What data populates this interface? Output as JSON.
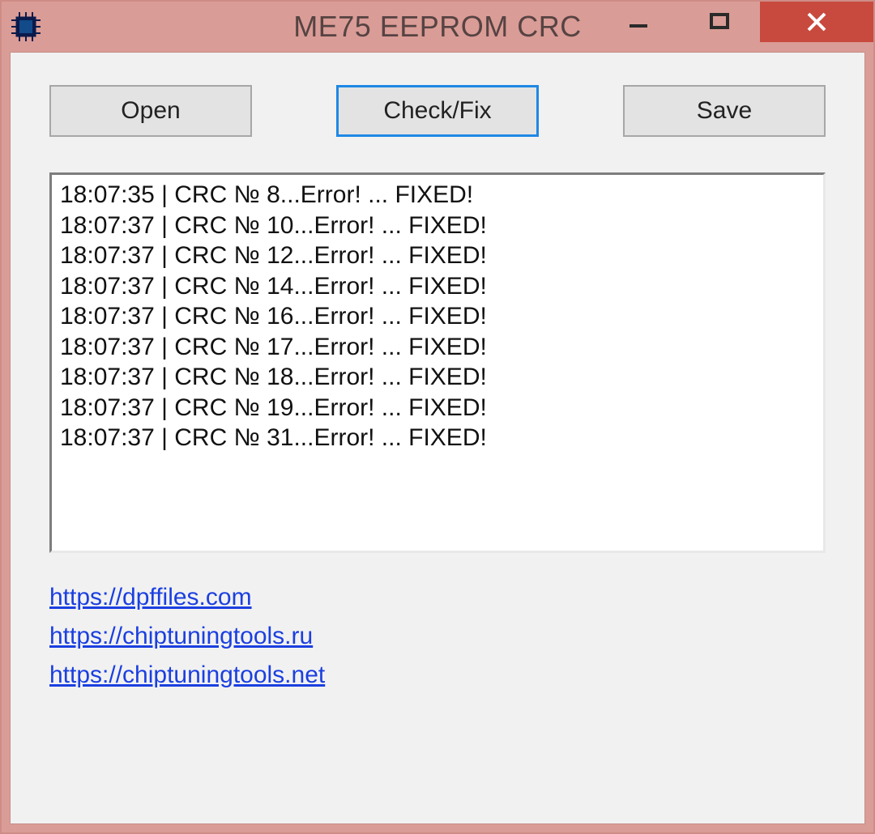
{
  "window": {
    "title": "ME75 EEPROM CRC"
  },
  "toolbar": {
    "open_label": "Open",
    "check_label": "Check/Fix",
    "save_label": "Save"
  },
  "log": {
    "lines": [
      "18:07:35 | CRC № 8...Error! ... FIXED!",
      "18:07:37 | CRC № 10...Error! ... FIXED!",
      "18:07:37 | CRC № 12...Error! ... FIXED!",
      "18:07:37 | CRC № 14...Error! ... FIXED!",
      "18:07:37 | CRC № 16...Error! ... FIXED!",
      "18:07:37 | CRC № 17...Error! ... FIXED!",
      "18:07:37 | CRC № 18...Error! ... FIXED!",
      "18:07:37 | CRC № 19...Error! ... FIXED!",
      "18:07:37 | CRC № 31...Error! ... FIXED!"
    ]
  },
  "links": [
    "https://dpffiles.com",
    "https://chiptuningtools.ru",
    "https://chiptuningtools.net"
  ]
}
